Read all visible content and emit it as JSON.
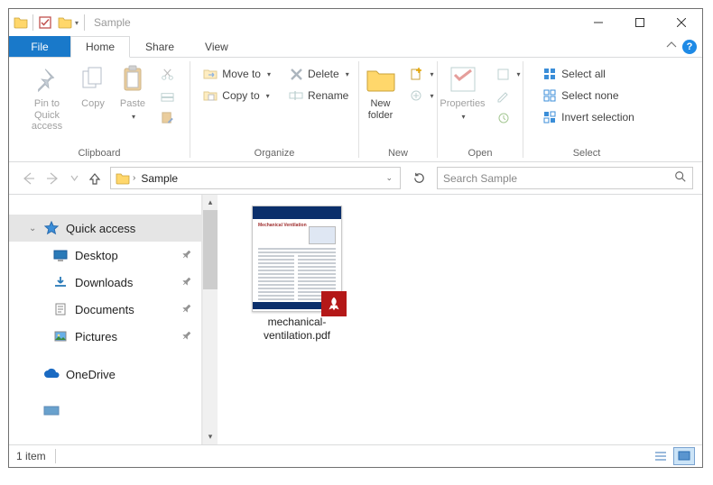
{
  "window": {
    "title": "Sample"
  },
  "tabs": {
    "file": "File",
    "items": [
      "Home",
      "Share",
      "View"
    ],
    "active": 0
  },
  "ribbon": {
    "clipboard": {
      "label": "Clipboard",
      "pin": "Pin to Quick access",
      "copy": "Copy",
      "paste": "Paste"
    },
    "organize": {
      "label": "Organize",
      "move_to": "Move to",
      "copy_to": "Copy to",
      "delete": "Delete",
      "rename": "Rename"
    },
    "new": {
      "label": "New",
      "new_folder": "New folder"
    },
    "open": {
      "label": "Open",
      "properties": "Properties"
    },
    "select": {
      "label": "Select",
      "all": "Select all",
      "none": "Select none",
      "invert": "Invert selection"
    }
  },
  "address": {
    "crumbs": [
      "Sample"
    ]
  },
  "search": {
    "placeholder": "Search Sample"
  },
  "navpane": {
    "quick_access": "Quick access",
    "items": [
      {
        "label": "Desktop",
        "pinned": true
      },
      {
        "label": "Downloads",
        "pinned": true
      },
      {
        "label": "Documents",
        "pinned": true
      },
      {
        "label": "Pictures",
        "pinned": true
      }
    ],
    "onedrive": "OneDrive"
  },
  "files": [
    {
      "label": "mechanical-ventilation.pdf",
      "type": "pdf"
    }
  ],
  "status": {
    "text": "1 item"
  }
}
